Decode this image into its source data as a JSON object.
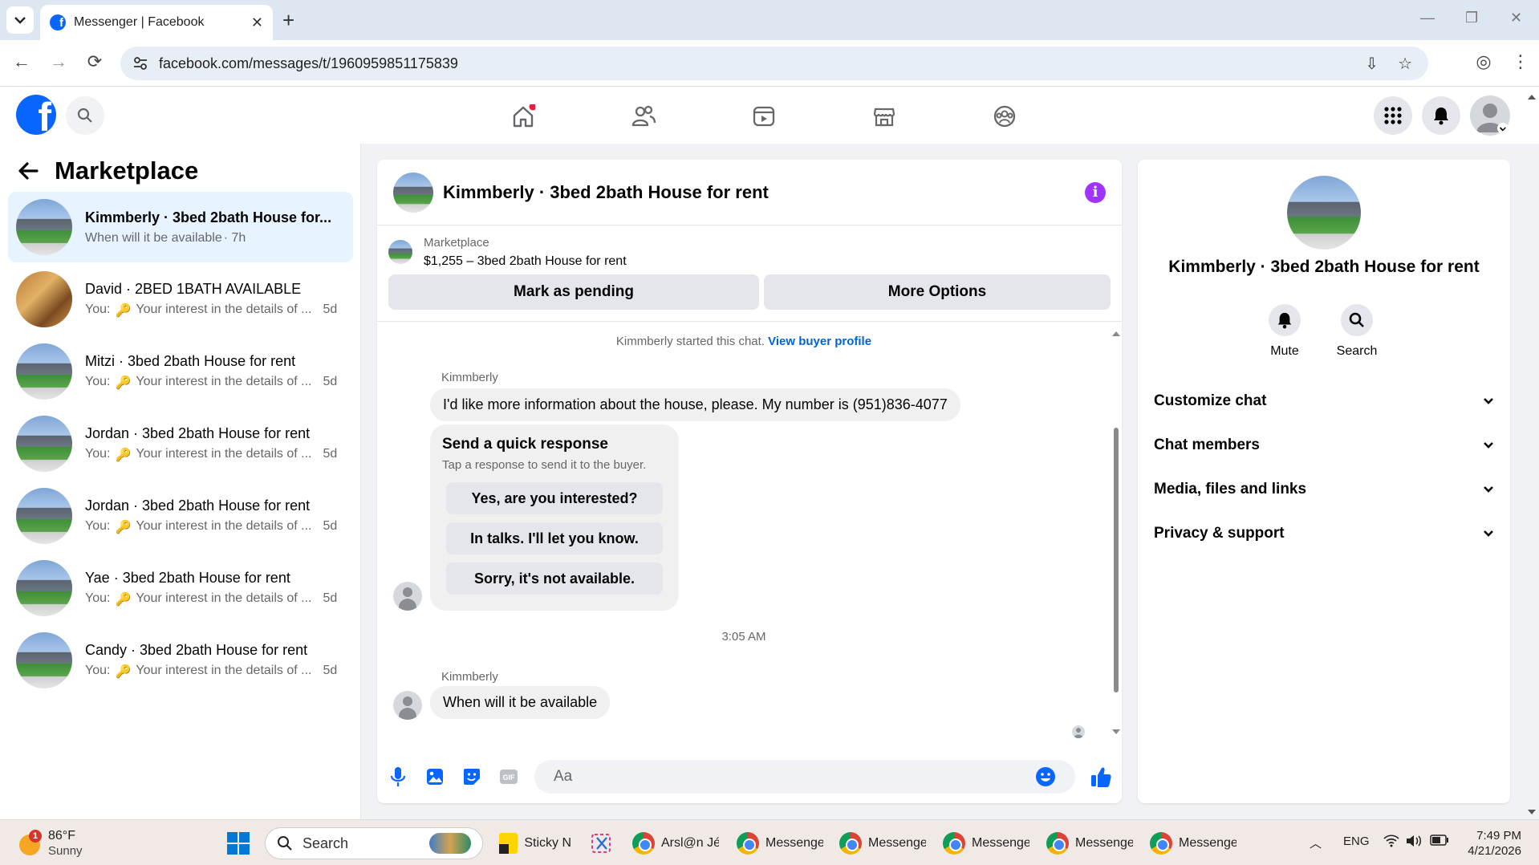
{
  "browser": {
    "tab_title": "Messenger | Facebook",
    "tab_close": "✕",
    "new_tab": "+",
    "url": "facebook.com/messages/t/1960959851175839"
  },
  "left_panel": {
    "title": "Marketplace",
    "conversations": [
      {
        "name": "Kimmberly · 3bed 2bath House for...",
        "prefix": "",
        "snippet": "When will it be available",
        "time": "· 7h",
        "avatar": "house"
      },
      {
        "name": "David · 2BED 1BATH AVAILABLE",
        "prefix": "You:",
        "snippet": "Your interest in the details of ...",
        "time": "5d",
        "avatar": "room"
      },
      {
        "name": "Mitzi · 3bed 2bath House for rent",
        "prefix": "You:",
        "snippet": "Your interest in the details of ...",
        "time": "5d",
        "avatar": "house"
      },
      {
        "name": "Jordan · 3bed 2bath House for rent",
        "prefix": "You:",
        "snippet": "Your interest in the details of ...",
        "time": "5d",
        "avatar": "house"
      },
      {
        "name": "Jordan · 3bed 2bath House for rent",
        "prefix": "You:",
        "snippet": "Your interest in the details of ...",
        "time": "5d",
        "avatar": "house"
      },
      {
        "name": "Yae · 3bed 2bath House for rent",
        "prefix": "You:",
        "snippet": "Your interest in the details of ...",
        "time": "5d",
        "avatar": "house"
      },
      {
        "name": "Candy · 3bed 2bath House for rent",
        "prefix": "You:",
        "snippet": "Your interest in the details of ...",
        "time": "5d",
        "avatar": "house"
      }
    ]
  },
  "chat": {
    "title": "Kimmberly · 3bed 2bath House for rent",
    "marketplace_label": "Marketplace",
    "listing": "$1,255 – 3bed 2bath House for rent",
    "mark_pending": "Mark as pending",
    "more_options": "More Options",
    "started_text": "Kimmberly started this chat.",
    "view_profile": "View buyer profile",
    "sender1": "Kimmberly",
    "message1": "I'd like more information about the house, please. My number is (951)836-4077",
    "quick_title": "Send a quick response",
    "quick_sub": "Tap a response to send it to the buyer.",
    "quick_responses": [
      "Yes, are you interested?",
      "In talks. I'll let you know.",
      "Sorry, it's not available."
    ],
    "timestamp": "3:05 AM",
    "sender2": "Kimmberly",
    "message2": "When will it be available",
    "input_placeholder": "Aa"
  },
  "right_panel": {
    "name": "Kimmberly · 3bed 2bath House for rent",
    "mute": "Mute",
    "search": "Search",
    "sections": [
      "Customize chat",
      "Chat members",
      "Media, files and links",
      "Privacy & support"
    ]
  },
  "taskbar": {
    "weather_temp": "86°F",
    "weather_desc": "Sunny",
    "weather_badge": "1",
    "search": "Search",
    "apps": [
      "Sticky N",
      "",
      "Arsl@n Jé",
      "Messenge",
      "Messenge",
      "Messenge",
      "Messenge",
      "Messenge"
    ],
    "lang": "ENG",
    "time": "7:49 PM",
    "date": "4/21/2026"
  },
  "colors": {
    "fb_blue": "#0866ff",
    "active_row": "#e7f3ff",
    "info_purple": "#a033ff",
    "link_blue": "#0064d1"
  }
}
